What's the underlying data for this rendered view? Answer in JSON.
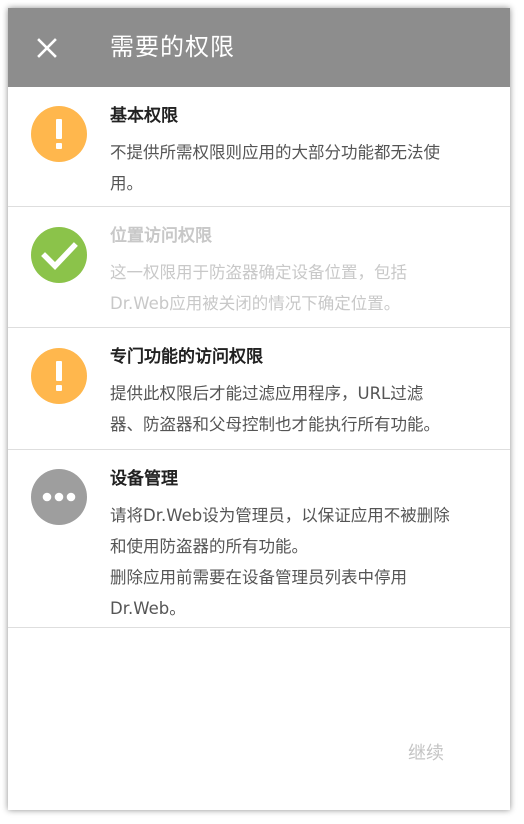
{
  "header": {
    "title": "需要的权限",
    "close_icon": "close-icon",
    "background": "#8d8d8d"
  },
  "items": [
    {
      "title": "基本权限",
      "description": "不提供所需权限则应用的大部分功能都无法使\n用。",
      "icon": "exclamation-icon",
      "icon_color": "#ffb74d",
      "enabled": true
    },
    {
      "title": "位置访问权限",
      "description": "这一权限用于防盗器确定设备位置，包括\nDr.Web应用被关闭的情况下确定位置。",
      "icon": "checkmark-icon",
      "icon_color": "#8bc34a",
      "enabled": false
    },
    {
      "title": "专门功能的访问权限",
      "description": "提供此权限后才能过滤应用程序，URL过滤\n器、防盗器和父母控制也才能执行所有功能。",
      "icon": "exclamation-icon",
      "icon_color": "#ffb74d",
      "enabled": true
    },
    {
      "title": "设备管理",
      "description": "请将Dr.Web设为管理员，以保证应用不被删除\n和使用防盗器的所有功能。\n删除应用前需要在设备管理员列表中停用\nDr.Web。",
      "icon": "more-dots-icon",
      "icon_color": "#9e9e9e",
      "enabled": true
    }
  ],
  "footer": {
    "continue_label": "继续",
    "continue_enabled": false
  }
}
